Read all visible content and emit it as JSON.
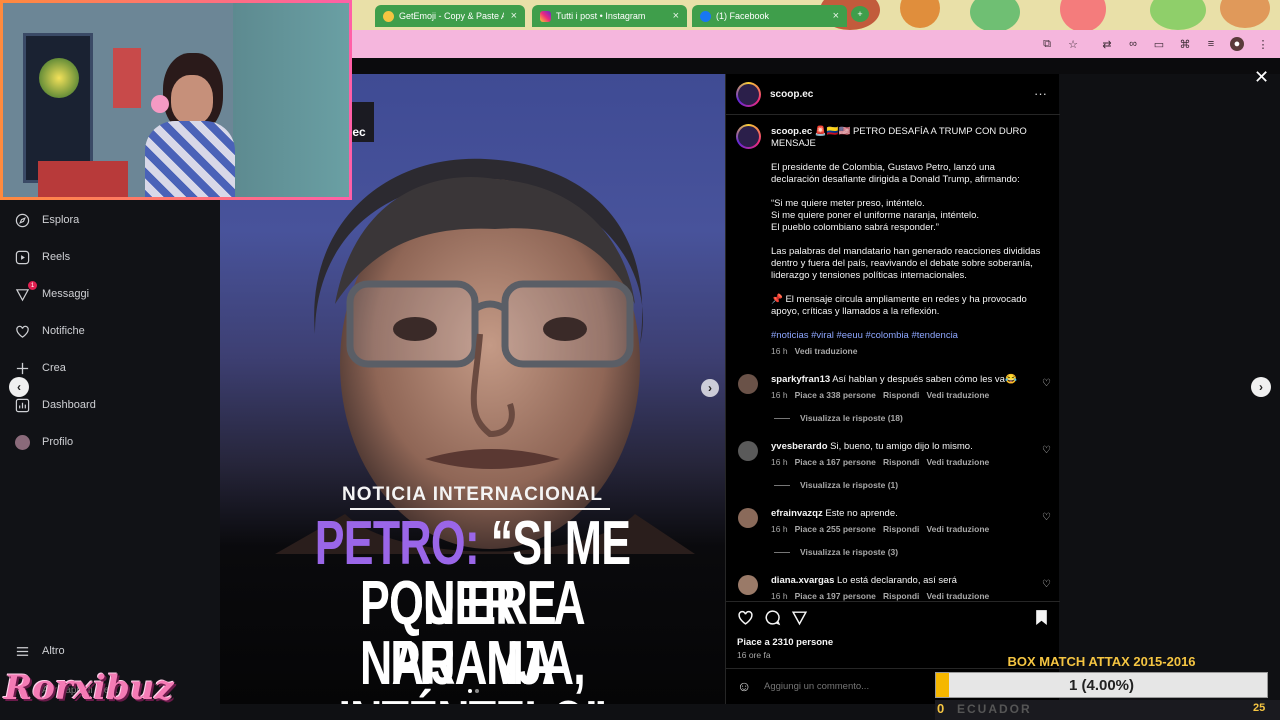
{
  "tabs": [
    {
      "label": "GetEmoji - Copy & Paste All",
      "icon": "emoji-icon"
    },
    {
      "label": "Tutti i post • Instagram",
      "icon": "instagram-icon"
    },
    {
      "label": "(1) Facebook",
      "icon": "facebook-icon"
    }
  ],
  "sidebar": {
    "items": [
      {
        "label": "Esplora",
        "icon": "compass-icon"
      },
      {
        "label": "Reels",
        "icon": "reels-icon"
      },
      {
        "label": "Messaggi",
        "icon": "messenger-icon",
        "badge": "1"
      },
      {
        "label": "Notifiche",
        "icon": "heart-icon"
      },
      {
        "label": "Crea",
        "icon": "plus-icon"
      },
      {
        "label": "Dashboard",
        "icon": "dashboard-icon"
      },
      {
        "label": "Profilo",
        "icon": "profile-icon"
      }
    ],
    "more": "Altro",
    "more_sub": "Altre app di Meta"
  },
  "post": {
    "kicker": "NOTICIA INTERNACIONAL",
    "headline_line1_a": "PETRO:",
    "headline_line1_b": "“SI ME QUIERE",
    "headline_line2": "PONER LA PIJAMA",
    "headline_line3": "NARANJA, INTÉNTELO”",
    "logo_text": "ec"
  },
  "panel": {
    "username": "scoop.ec",
    "caption_user": "scoop.ec",
    "caption_title": "🚨🇨🇴🇺🇸 PETRO DESAFÍA A TRUMP CON DURO MENSAJE",
    "caption_p1": "El presidente de Colombia, Gustavo Petro, lanzó una declaración desafiante dirigida a Donald Trump, afirmando:",
    "caption_q1": "“Si me quiere meter preso, inténtelo.",
    "caption_q2": "Si me quiere poner el uniforme naranja, inténtelo.",
    "caption_q3": "El pueblo colombiano sabrá responder.”",
    "caption_p3": "Las palabras del mandatario han generado reacciones divididas dentro y fuera del país, reavivando el debate sobre soberanía, liderazgo y tensiones políticas internacionales.",
    "caption_p4": "📌 El mensaje circula ampliamente en redes y ha provocado apoyo, críticas y llamados a la reflexión.",
    "hashtags": "#noticias #viral #eeuu #colombia #tendencia",
    "caption_time": "16 h",
    "see_translation": "Vedi traduzione",
    "likes": "Piace a 2310 persone",
    "posted": "16 ore fa",
    "comment_placeholder": "Aggiungi un commento..."
  },
  "comments": [
    {
      "user": "sparkyfran13",
      "text": "Así hablan y después saben cómo les va😂",
      "time": "16 h",
      "likes": "Piace a 338 persone",
      "reply": "Rispondi",
      "translate": "Vedi traduzione",
      "replies": "Visualizza le risposte (18)"
    },
    {
      "user": "yvesberardo",
      "text": "Si, bueno, tu amigo dijo lo mismo.",
      "time": "16 h",
      "likes": "Piace a 167 persone",
      "reply": "Rispondi",
      "translate": "Vedi traduzione",
      "replies": "Visualizza le risposte (1)"
    },
    {
      "user": "efrainvazqz",
      "text": "Este no aprende.",
      "time": "16 h",
      "likes": "Piace a 255 persone",
      "reply": "Rispondi",
      "translate": "Vedi traduzione",
      "replies": "Visualizza le risposte (3)"
    },
    {
      "user": "diana.xvargas",
      "text": "Lo está declarando, así será",
      "time": "16 h",
      "likes": "Piace a 197 persone",
      "reply": "Rispondi",
      "translate": "Vedi traduzione",
      "replies": ""
    }
  ],
  "overlay": {
    "streamer": "Rorxibuz",
    "box_title": "BOX MATCH ATTAX 2015-2016",
    "box_label": "1 (4.00%)",
    "box_progress": 0.04,
    "left_num": "0",
    "ticker": "ECUADOR",
    "right_num": "25"
  }
}
